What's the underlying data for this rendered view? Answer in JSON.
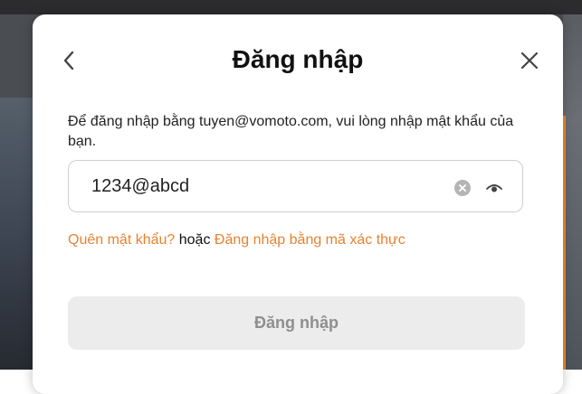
{
  "modal": {
    "title": "Đăng nhập",
    "description": "Để đăng nhập bằng tuyen@vomoto.com, vui lòng nhập mật khẩu của bạn.",
    "password": {
      "value": "1234@abcd",
      "type": "text"
    },
    "links": {
      "forgot": "Quên mật khẩu?",
      "or": "hoặc",
      "otp": "Đăng nhập bằng mã xác thực"
    },
    "submit_label": "Đăng nhập"
  },
  "colors": {
    "accent": "#e8822f",
    "disabled_bg": "#ececec",
    "disabled_text": "#8f8f8f"
  }
}
